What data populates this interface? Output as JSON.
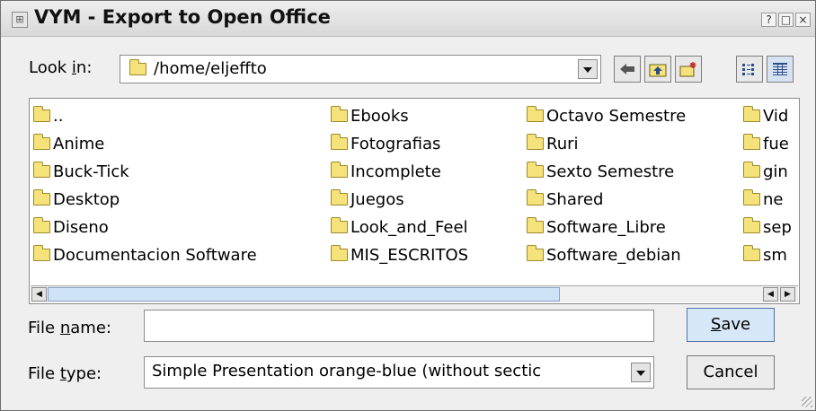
{
  "window": {
    "title": "VYM - Export to Open Office",
    "title_buttons": [
      "?",
      "□",
      "×"
    ]
  },
  "lookin": {
    "label_prefix": "Look ",
    "label_mnemonic": "i",
    "label_suffix": "n:",
    "path": "/home/eljeffto"
  },
  "toolbar": {
    "back_icon": "left-arrow-icon",
    "parent_icon": "parent-folder-icon",
    "new_folder_icon": "new-folder-icon",
    "list_view_icon": "list-view-icon",
    "detail_view_icon": "detail-view-icon"
  },
  "files": {
    "columns": [
      [
        "..",
        "Anime",
        "Buck-Tick",
        "Desktop",
        "Diseno",
        "Documentacion Software"
      ],
      [
        "Ebooks",
        "Fotografias",
        "Incomplete",
        "Juegos",
        "Look_and_Feel",
        "MIS_ESCRITOS"
      ],
      [
        "Octavo Semestre",
        "Ruri",
        "Sexto Semestre",
        "Shared",
        "Software_Libre",
        "Software_debian"
      ],
      [
        "Vid",
        "fue",
        "gin",
        "ne",
        "sep",
        "sm"
      ]
    ]
  },
  "filename": {
    "label_prefix": "File ",
    "label_mnemonic": "n",
    "label_suffix": "ame:",
    "value": ""
  },
  "filetype": {
    "label_prefix": "File ",
    "label_mnemonic": "t",
    "label_suffix": "ype:",
    "value": "Simple Presentation orange-blue (without sectic"
  },
  "buttons": {
    "save_mnemonic": "S",
    "save_rest": "ave",
    "cancel": "Cancel"
  }
}
